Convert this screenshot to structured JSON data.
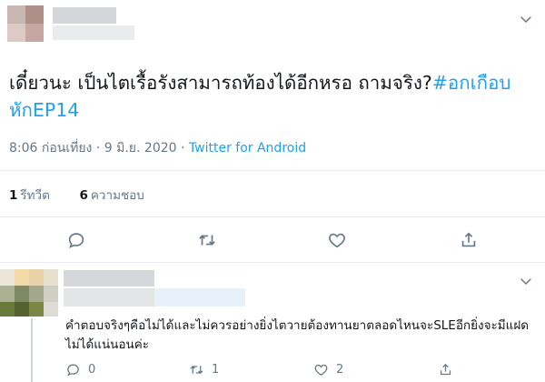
{
  "tweet": {
    "text_main": "เดี๋ยวนะ เป็นไตเรื้อรังสามารถท้องได้อีกหรอ ถามจริง?",
    "hashtag": "#อกเกือบหักEP14",
    "time": "8:06 ก่อนเที่ยง",
    "separator": "·",
    "date": "9 มิ.ย. 2020",
    "source": "Twitter for Android",
    "retweet_count": "1",
    "retweet_label": "รีทวีต",
    "like_count": "6",
    "like_label": "ความชอบ"
  },
  "reply": {
    "text": "คำตอบจริงๆคือไม่ได้และไม่ควรอย่างยิ่งไตวายต้องทานยาตลอดไหนจะSLEอีกยิ่งจะมีแฝดไม่ได้แน่นอนค่ะ",
    "reply_count": "0",
    "retweet_count": "1",
    "like_count": "2"
  },
  "icons": [
    "chevron-down-icon",
    "reply-icon",
    "retweet-icon",
    "like-icon",
    "share-icon"
  ],
  "colors": {
    "accent": "#1da1f2",
    "muted": "#657786",
    "divider": "#e6ecf0"
  }
}
